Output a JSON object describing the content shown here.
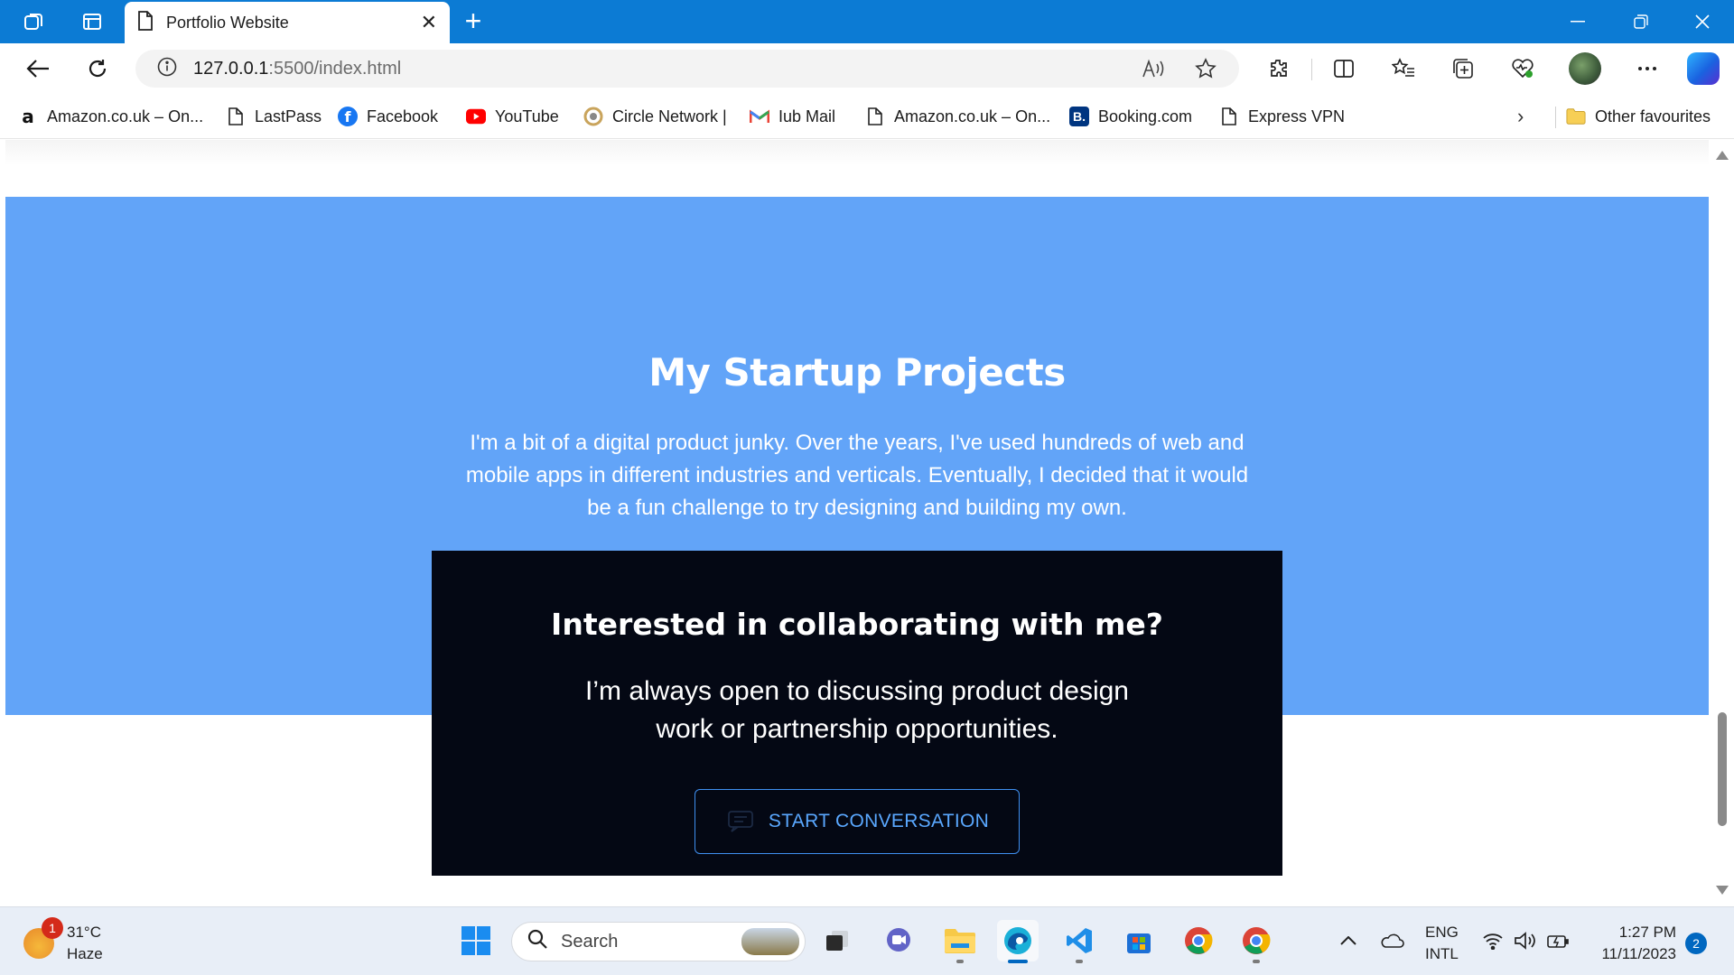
{
  "browser": {
    "tab_title": "Portfolio Website",
    "tab_close": "✕",
    "new_tab": "+",
    "url_host": "127.0.0.1",
    "url_path": ":5500/index.html"
  },
  "favourites": [
    {
      "label": "Amazon.co.uk – On...",
      "icon": "amazon-icon"
    },
    {
      "label": "LastPass",
      "icon": "page-icon"
    },
    {
      "label": "Facebook",
      "icon": "facebook-icon"
    },
    {
      "label": "YouTube",
      "icon": "youtube-icon"
    },
    {
      "label": "Circle Network |",
      "icon": "circle-network-icon"
    },
    {
      "label": "Iub Mail",
      "icon": "gmail-icon"
    },
    {
      "label": "Amazon.co.uk – On...",
      "icon": "page-icon"
    },
    {
      "label": "Booking.com",
      "icon": "booking-icon"
    },
    {
      "label": "Express VPN",
      "icon": "page-icon"
    }
  ],
  "favourites_more": "›",
  "other_favourites": "Other favourites",
  "page": {
    "hero_title": "My Startup Projects",
    "hero_text": "I'm a bit of a digital product junky. Over the years, I've used hundreds of web and mobile apps in different industries and verticals. Eventually, I decided that it would be a fun challenge to try designing and building my own.",
    "cta_title": "Interested in collaborating with me?",
    "cta_text": "I’m always open to discussing product design work or partnership opportunities.",
    "cta_button": "START CONVERSATION"
  },
  "colors": {
    "hero_bg": "#62a4f8",
    "cta_bg": "#040814",
    "cta_button_text": "#5aa8ff",
    "titlebar": "#0c7bd4"
  },
  "taskbar": {
    "weather_temp": "31°C",
    "weather_desc": "Haze",
    "weather_badge": "1",
    "search_label": "Search",
    "lang_line1": "ENG",
    "lang_line2": "INTL",
    "time": "1:27 PM",
    "date": "11/11/2023",
    "notifications": "2"
  }
}
